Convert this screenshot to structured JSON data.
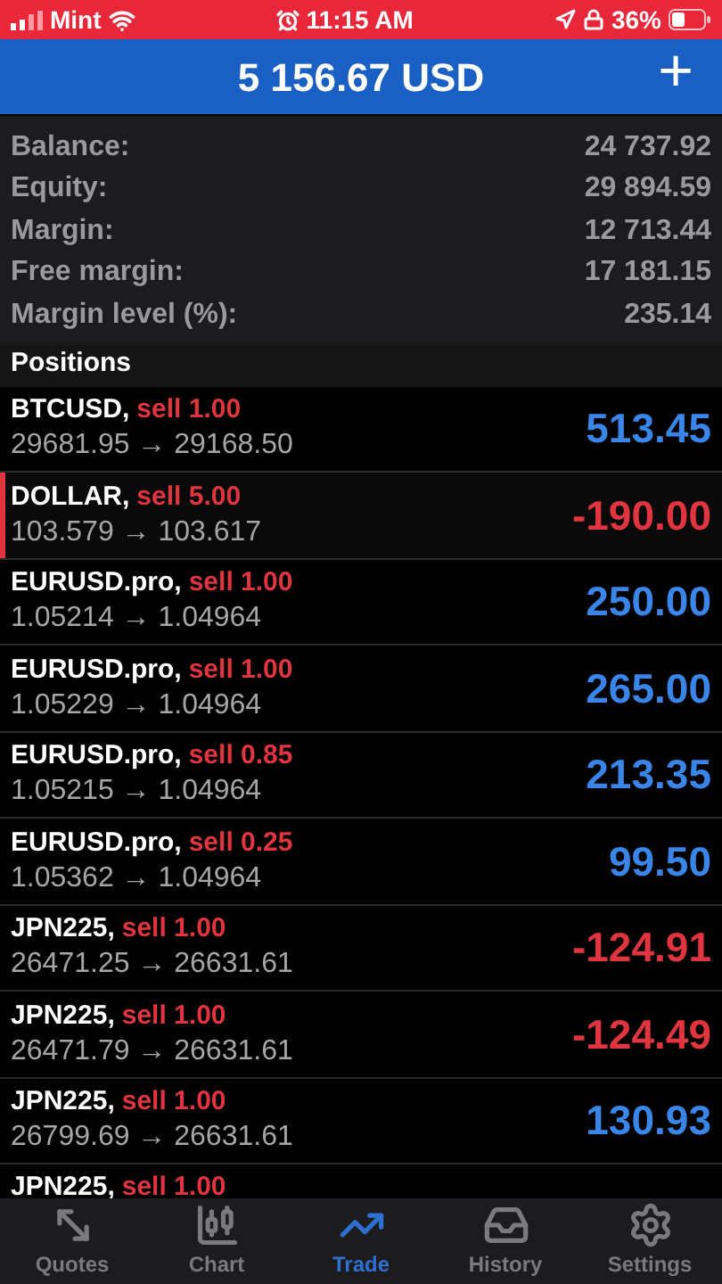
{
  "status_bar": {
    "carrier": "Mint",
    "time": "11:15 AM",
    "battery": "36%"
  },
  "header": {
    "title": "5 156.67 USD",
    "add_button": "+"
  },
  "summary": [
    {
      "label": "Balance:",
      "value": "24 737.92"
    },
    {
      "label": "Equity:",
      "value": "29 894.59"
    },
    {
      "label": "Margin:",
      "value": "12 713.44"
    },
    {
      "label": "Free margin:",
      "value": "17 181.15"
    },
    {
      "label": "Margin level (%):",
      "value": "235.14"
    }
  ],
  "positions": {
    "title": "Positions",
    "rows": [
      {
        "symbol": "BTCUSD,",
        "order": "sell 1.00",
        "prices": "29681.95 → 29168.50",
        "profit": "513.45",
        "kind": "gain",
        "highlighted": false
      },
      {
        "symbol": "DOLLAR,",
        "order": "sell 5.00",
        "prices": "103.579 → 103.617",
        "profit": "-190.00",
        "kind": "loss",
        "highlighted": true
      },
      {
        "symbol": "EURUSD.pro,",
        "order": "sell 1.00",
        "prices": "1.05214 → 1.04964",
        "profit": "250.00",
        "kind": "gain",
        "highlighted": false
      },
      {
        "symbol": "EURUSD.pro,",
        "order": "sell 1.00",
        "prices": "1.05229 → 1.04964",
        "profit": "265.00",
        "kind": "gain",
        "highlighted": false
      },
      {
        "symbol": "EURUSD.pro,",
        "order": "sell 0.85",
        "prices": "1.05215 → 1.04964",
        "profit": "213.35",
        "kind": "gain",
        "highlighted": false
      },
      {
        "symbol": "EURUSD.pro,",
        "order": "sell 0.25",
        "prices": "1.05362 → 1.04964",
        "profit": "99.50",
        "kind": "gain",
        "highlighted": false
      },
      {
        "symbol": "JPN225,",
        "order": "sell 1.00",
        "prices": "26471.25 → 26631.61",
        "profit": "-124.91",
        "kind": "loss",
        "highlighted": false
      },
      {
        "symbol": "JPN225,",
        "order": "sell 1.00",
        "prices": "26471.79 → 26631.61",
        "profit": "-124.49",
        "kind": "loss",
        "highlighted": false
      },
      {
        "symbol": "JPN225,",
        "order": "sell 1.00",
        "prices": "26799.69 → 26631.61",
        "profit": "130.93",
        "kind": "gain",
        "highlighted": false
      },
      {
        "symbol": "JPN225,",
        "order": "sell 1.00",
        "highlighted": false
      }
    ]
  },
  "tab_bar": [
    {
      "label": "Quotes",
      "kind": "quotes",
      "selected": false
    },
    {
      "label": "Chart",
      "kind": "chart",
      "selected": false
    },
    {
      "label": "Trade",
      "kind": "trade",
      "selected": true
    },
    {
      "label": "History",
      "kind": "history",
      "selected": false
    },
    {
      "label": "Settings",
      "kind": "settings",
      "selected": false
    }
  ]
}
